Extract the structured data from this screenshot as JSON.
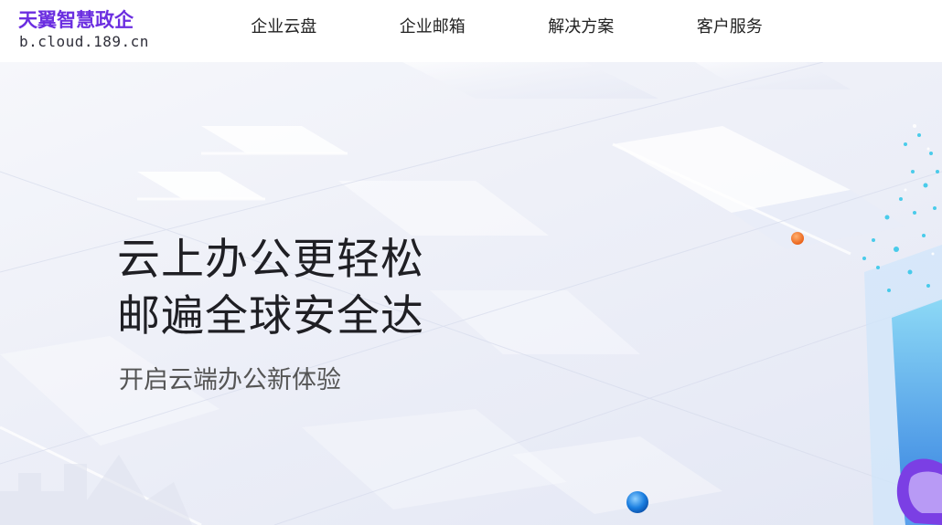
{
  "header": {
    "logo": {
      "title": "天翼智慧政企",
      "url": "b.cloud.189.cn"
    },
    "nav": [
      {
        "label": "企业云盘"
      },
      {
        "label": "企业邮箱"
      },
      {
        "label": "解决方案"
      },
      {
        "label": "客户服务"
      }
    ]
  },
  "hero": {
    "headline_line1": "云上办公更轻松",
    "headline_line2": "邮遍全球安全达",
    "subheadline": "开启云端办公新体验"
  },
  "colors": {
    "brand_purple": "#6b2ee0",
    "accent_orange": "#f26a1b",
    "accent_blue": "#1a7ee0",
    "accent_cyan": "#2ec6e8"
  }
}
